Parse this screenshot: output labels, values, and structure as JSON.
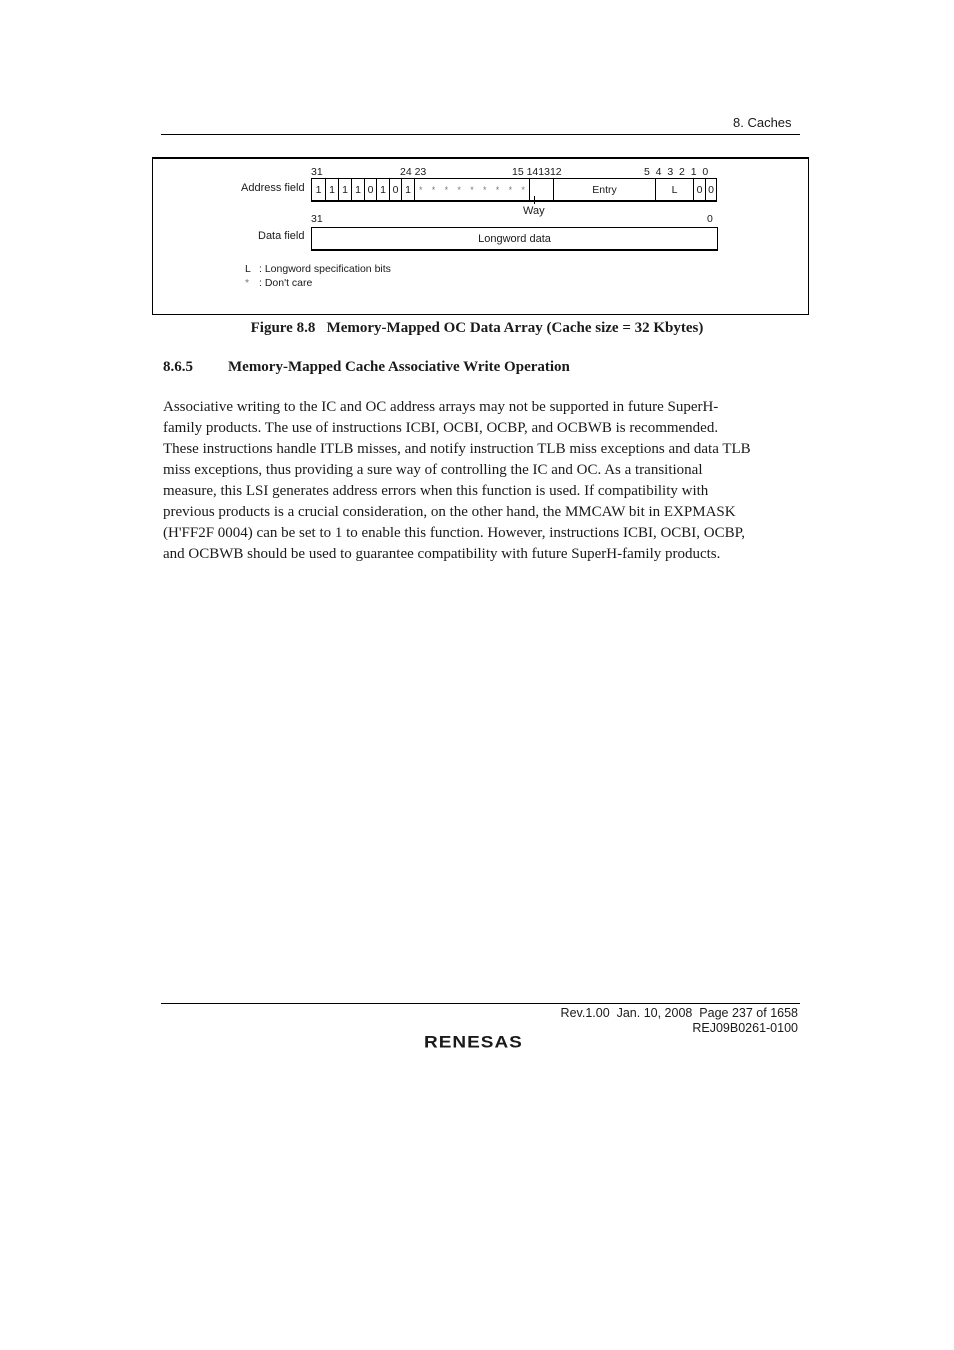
{
  "header": {
    "running_head": "8.  Caches"
  },
  "figure": {
    "address_field_label": "Address field",
    "data_field_label": "Data field",
    "address_bit_labels": {
      "b31": "31",
      "b24_23": "24 23",
      "b15_12": "15 141312",
      "b5_0": "5  4  3  2  1  0"
    },
    "address_fixed_bits": [
      "1",
      "1",
      "1",
      "1",
      "0",
      "1",
      "0",
      "1"
    ],
    "dont_care_symbol": "*",
    "dont_care_count": 9,
    "entry_label": "Entry",
    "l_label": "L",
    "low_bits": [
      "0",
      "0"
    ],
    "way_label": "Way",
    "data_bit_labels": {
      "high": "31",
      "low": "0"
    },
    "data_label": "Longword data",
    "legend": [
      {
        "key": "L",
        "text": ": Longword specification bits"
      },
      {
        "key": "*",
        "text": ": Don't care"
      }
    ],
    "caption": "Figure 8.8   Memory-Mapped OC Data Array (Cache size = 32 Kbytes)"
  },
  "section": {
    "number": "8.6.5",
    "title": "Memory-Mapped Cache Associative Write Operation",
    "paragraph_lines": [
      "Associative writing to the IC and OC address arrays may not be supported in future SuperH-",
      "family products. The use of instructions ICBI, OCBI, OCBP, and OCBWB is recommended.",
      "These instructions handle ITLB misses, and notify instruction TLB miss exceptions and data TLB",
      "miss exceptions, thus providing a sure way of controlling the IC and OC. As a transitional",
      "measure, this LSI generates address errors when this function is used. If compatibility with",
      "previous products is a crucial consideration, on the other hand, the MMCAW bit in EXPMASK",
      "(H'FF2F 0004) can be set to 1 to enable this function. However, instructions ICBI, OCBI, OCBP,",
      "and OCBWB should be used to guarantee compatibility with future SuperH-family products."
    ]
  },
  "footer": {
    "revision": "Rev.1.00  Jan. 10, 2008  Page 237 of 1658",
    "doc_number": "REJ09B0261-0100",
    "logo_text": "RENESAS"
  }
}
